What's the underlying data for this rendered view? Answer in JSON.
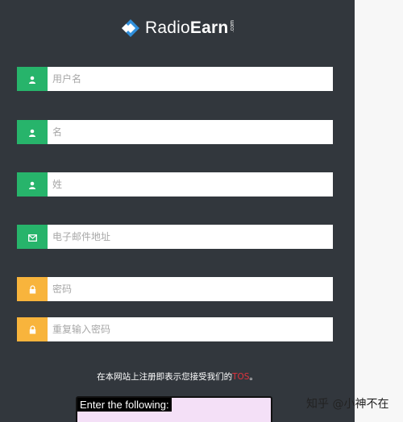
{
  "brand": {
    "name_regular": "Radio",
    "name_bold": "Earn",
    "suffix": ".com",
    "colors": {
      "mark_blue": "#2f8fdc",
      "mark_white": "#ffffff"
    }
  },
  "form": {
    "username": {
      "placeholder": "用户名",
      "icon": "user-icon"
    },
    "first_name": {
      "placeholder": "名",
      "icon": "user-icon"
    },
    "last_name": {
      "placeholder": "姓",
      "icon": "user-icon"
    },
    "email": {
      "placeholder": "电子邮件地址",
      "icon": "envelope-icon"
    },
    "password": {
      "placeholder": "密码",
      "icon": "lock-icon"
    },
    "password_confirm": {
      "placeholder": "重复输入密码",
      "icon": "lock-icon"
    }
  },
  "tos": {
    "prefix": "在本网站上注册即表示您接受我们的",
    "link": "TOS",
    "suffix": "。"
  },
  "captcha": {
    "label": "Enter the following:"
  },
  "watermark": {
    "text": "知乎 @小神不在"
  },
  "colors": {
    "panel_bg": "#32373d",
    "addon_green": "#27b46b",
    "addon_yellow": "#f8b43c",
    "tos_link": "#e0323c",
    "captcha_bg": "#f4e0f7"
  }
}
